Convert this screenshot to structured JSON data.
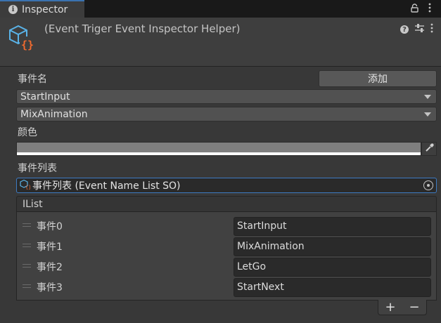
{
  "tab": {
    "title": "Inspector"
  },
  "header": {
    "title": "(Event Triger Event Inspector Helper)"
  },
  "event_name": {
    "label": "事件名",
    "add_button": "添加"
  },
  "dropdowns": [
    {
      "value": "StartInput"
    },
    {
      "value": "MixAnimation"
    }
  ],
  "color": {
    "label": "颜色",
    "value": "#7f7f7f"
  },
  "event_list_field": {
    "label": "事件列表",
    "value": "事件列表 (Event Name List SO)"
  },
  "ilist": {
    "header": "IList",
    "items": [
      {
        "label": "事件0",
        "value": "StartInput"
      },
      {
        "label": "事件1",
        "value": "MixAnimation"
      },
      {
        "label": "事件2",
        "value": "LetGo"
      },
      {
        "label": "事件3",
        "value": "StartNext"
      }
    ],
    "add_label": "+",
    "remove_label": "−"
  },
  "colors": {
    "accent": "#3d7bc3",
    "background": "#383838"
  }
}
